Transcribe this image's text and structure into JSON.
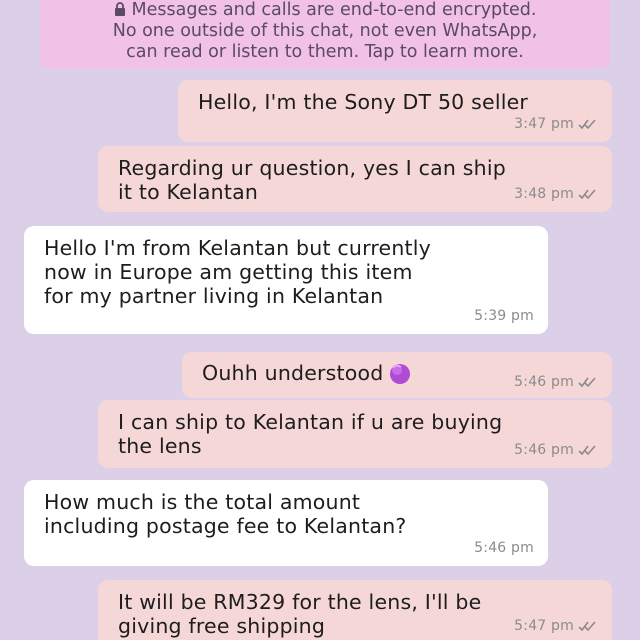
{
  "encryption_notice": {
    "lines": [
      "Messages and calls are end-to-end encrypted.",
      "No one outside of this chat, not even WhatsApp,",
      "can read or listen to them. Tap to learn more."
    ],
    "icon": "lock-icon"
  },
  "messages": [
    {
      "direction": "outgoing",
      "lines": [
        "Hello, I'm the Sony DT 50 seller"
      ],
      "time": "3:47 pm",
      "status": "read"
    },
    {
      "direction": "outgoing",
      "lines": [
        "Regarding ur question, yes I can ship",
        "it to Kelantan"
      ],
      "time": "3:48 pm",
      "status": "read"
    },
    {
      "direction": "incoming",
      "lines": [
        "Hello I'm from Kelantan but currently",
        "now in Europe am getting this item",
        "for my partner living in Kelantan"
      ],
      "time": "5:39 pm"
    },
    {
      "direction": "outgoing",
      "lines": [
        "Ouhh understood"
      ],
      "emoji": "purple-heart-hand-emoji",
      "time": "5:46 pm",
      "status": "read"
    },
    {
      "direction": "outgoing",
      "lines": [
        "I can ship to Kelantan if u are buying",
        "the lens"
      ],
      "time": "5:46 pm",
      "status": "read"
    },
    {
      "direction": "incoming",
      "lines": [
        "How much is the total amount",
        "including postage fee to Kelantan?"
      ],
      "time": "5:46 pm"
    },
    {
      "direction": "outgoing",
      "lines": [
        "It will be RM329 for the lens, I'll be",
        "giving free shipping"
      ],
      "time": "5:47 pm",
      "status": "read"
    }
  ],
  "colors": {
    "background": "#dcd0e9",
    "notice_bg": "#f1c2e6",
    "outgoing_bg": "#f6d7d7",
    "incoming_bg": "#ffffff",
    "read_tick": "#8b8b8b"
  }
}
